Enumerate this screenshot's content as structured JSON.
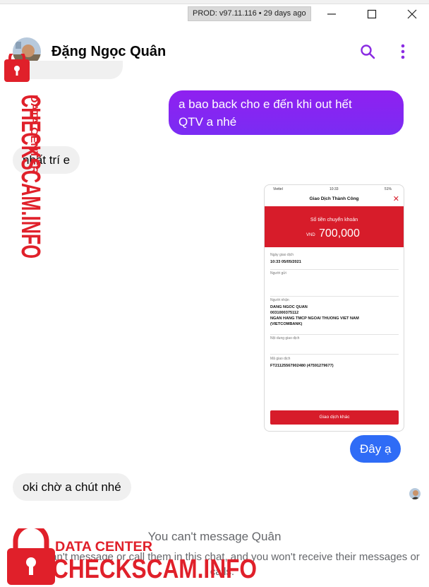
{
  "window": {
    "build_badge": "PROD: v97.11.116 • 29 days ago"
  },
  "header": {
    "contact_name": "Đặng Ngọc Quân"
  },
  "messages": [
    {
      "id": "m1",
      "direction": "out",
      "text": "a bao back cho e đến khi out hết\nQTV a nhé"
    },
    {
      "id": "m2",
      "direction": "in",
      "text": "nhất trí e"
    },
    {
      "id": "m3",
      "direction": "out",
      "type": "image"
    },
    {
      "id": "m4",
      "direction": "out",
      "text": "Đây ạ"
    },
    {
      "id": "m5",
      "direction": "in",
      "text": "oki chờ a chút nhé"
    }
  ],
  "receipt": {
    "status_carrier": "Viettel",
    "status_time": "10:33",
    "status_battery": "51%",
    "title": "Giao Dịch Thành Công",
    "amount_label": "Số tiền chuyển khoản",
    "currency": "VND",
    "amount": "700,000",
    "fields": [
      {
        "key": "Ngày giao dịch",
        "lines": [
          "10:33 05/05/2021"
        ]
      },
      {
        "key": "Người gửi",
        "lines": []
      },
      {
        "key": "Người nhận",
        "lines": [
          "DANG NGOC QUAN",
          "0031000375112",
          "NGAN HANG TMCP NGOAI THUONG VIET NAM",
          "(VIETCOMBANK)"
        ]
      },
      {
        "key": "Nội dung giao dịch",
        "lines": []
      },
      {
        "key": "Mã giao dịch",
        "lines": [
          "FT21125567902480 (47591279677)"
        ]
      }
    ],
    "button_label": "Giao dịch khác"
  },
  "notice": {
    "title": "You can't message Quân",
    "subtitle": "You can't message or call them in this chat, and you won't receive their messages or calls."
  },
  "watermark": {
    "line1": "DATA CENTER",
    "line2": "CHECKSCAM.INFO"
  },
  "colors": {
    "messenger_purple": "#8a2be2",
    "outgoing_gradient_top": "#8f20f0",
    "outgoing_blue": "#2f6cf6",
    "incoming_gray": "#f0f0f0",
    "watermark_red": "#e0202a",
    "receipt_red": "#d71c2a"
  }
}
